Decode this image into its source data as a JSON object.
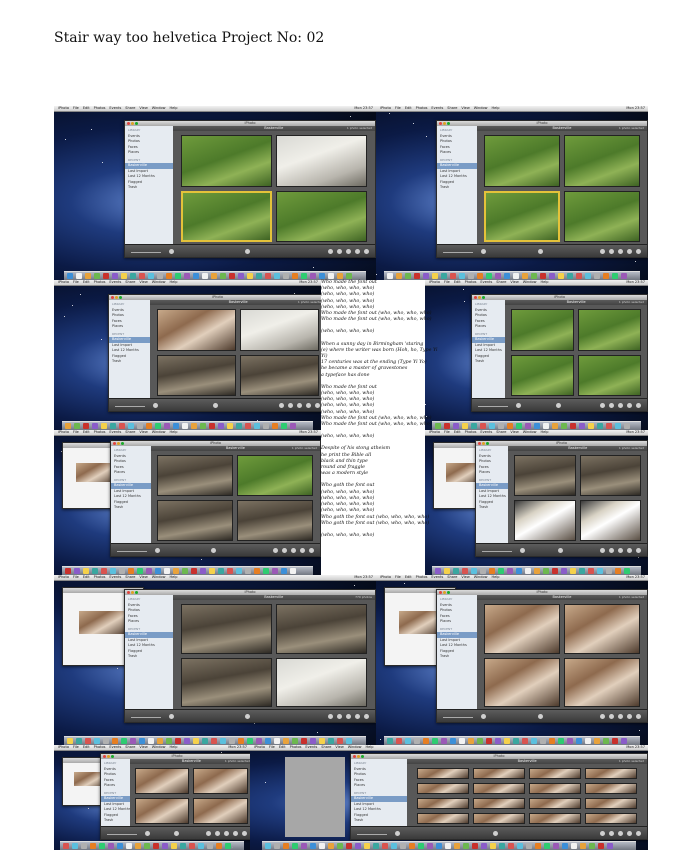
{
  "document": {
    "title": "Stair way too helvetica Project No: 02"
  },
  "menubar": {
    "app_items": [
      "iPhoto",
      "File",
      "Edit",
      "Photos",
      "Events",
      "Share",
      "View",
      "Window",
      "Help"
    ],
    "clock": "Mon 23:57"
  },
  "iphoto": {
    "window_title": "iPhoto",
    "event_name": "Baskerville",
    "selection_status": "1 photo selected",
    "photo_count_status": "770 photos",
    "sidebar": {
      "library_header": "LIBRARY",
      "library_items": [
        "Events",
        "Photos",
        "Faces",
        "Places"
      ],
      "recent_header": "RECENT",
      "recent_items": [
        "Baskerville",
        "Last Import",
        "Last 12 Months",
        "Flagged",
        "Trash"
      ]
    },
    "toolbar_labels": [
      "Search",
      "Zoom",
      "Slideshow",
      "Info",
      "Edit",
      "Create",
      "Add To",
      "Share"
    ]
  },
  "lyrics": [
    "Who made the font out",
    "(who, who, who, who)",
    "(who, who, who, who)",
    "(who, who, who, who)",
    "(who, who, who, who)",
    "Who made the font out (who, who, who, who)",
    "Who made the font out (who, who, who, who)",
    "",
    "(who, who, who, who)",
    "",
    "When a sunny day in Birmingham 'staring",
    "(e) where the writer was born (Hoh, ho, Type Yi",
    "Yi)",
    "17 centuries was at the ending (Type Yi Yo)",
    "he became a master of gravestones",
    "a typeface has done",
    "",
    "Who made the font out",
    "(who, who, who, who)",
    "(who, who, who, who)",
    "(who, who, who, who)",
    "(who, who, who, who)",
    "Who made the font out (who, who, who, who)",
    "Who made the font out (who, who, who, who)",
    "",
    "(who, who, who, who)",
    "",
    "Despite of his stong atheism",
    "he print the Bible all",
    "black and thin type",
    "round and fraggle",
    "was a modern style",
    "",
    "Who goth the font out",
    "(who, who, who, who)",
    "(who, who, who, who)",
    "(who, who, who, who)",
    "(who, who, who, who)",
    "Who goth the font out (who, who, who, who)",
    "Who goth the font out (who, who, who, who)",
    "",
    "(who, who, who, who)"
  ],
  "colors": {
    "selection_border": "#e4c23a",
    "sidebar_selected": "#7a9cc6",
    "window_bg": "#6b6b6b"
  }
}
